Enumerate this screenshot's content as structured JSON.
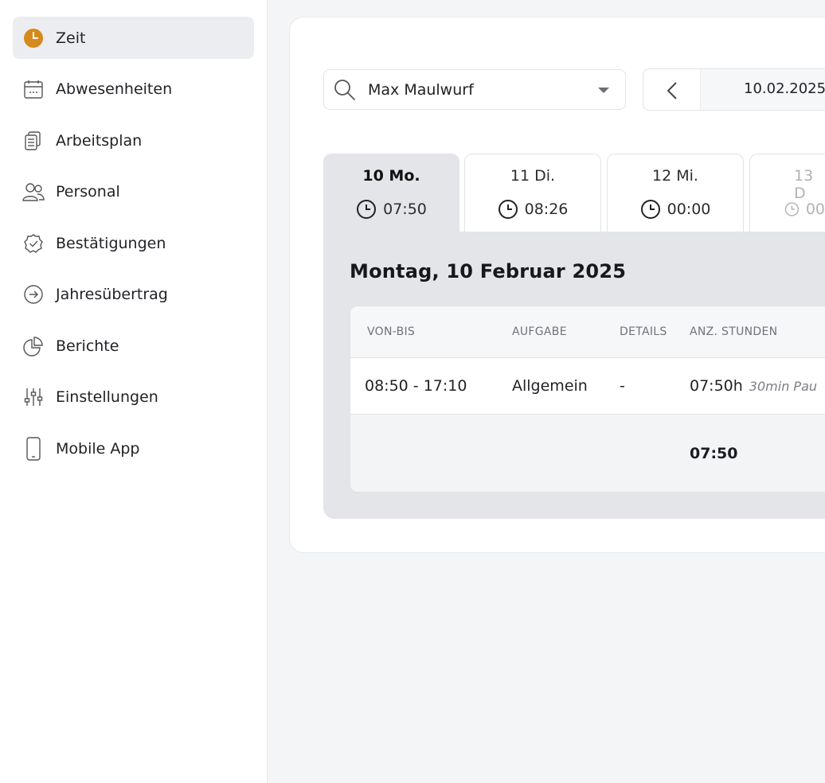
{
  "sidebar": {
    "items": [
      {
        "label": "Zeit",
        "icon": "clock-icon",
        "active": true
      },
      {
        "label": "Abwesenheiten",
        "icon": "calendar-icon"
      },
      {
        "label": "Arbeitsplan",
        "icon": "clipboard-icon"
      },
      {
        "label": "Personal",
        "icon": "users-icon"
      },
      {
        "label": "Bestätigungen",
        "icon": "badge-check-icon"
      },
      {
        "label": "Jahresübertrag",
        "icon": "arrow-circle-right-icon"
      },
      {
        "label": "Berichte",
        "icon": "pie-chart-icon"
      },
      {
        "label": "Einstellungen",
        "icon": "sliders-icon"
      },
      {
        "label": "Mobile App",
        "icon": "smartphone-icon"
      }
    ]
  },
  "filters": {
    "employee": "Max Maulwurf",
    "date": "10.02.2025"
  },
  "tabs": [
    {
      "day": "10 Mo.",
      "time": "07:50"
    },
    {
      "day": "11 Di.",
      "time": "08:26"
    },
    {
      "day": "12 Mi.",
      "time": "00:00"
    },
    {
      "day": "13 D",
      "time": "00"
    }
  ],
  "day_panel": {
    "title": "Montag, 10 Februar 2025",
    "columns": [
      "VON-BIS",
      "AUFGABE",
      "DETAILS",
      "ANZ. STUNDEN"
    ],
    "rows": [
      {
        "range": "08:50 - 17:10",
        "task": "Allgemein",
        "details": "-",
        "hours": "07:50h",
        "note": "30min Pau"
      }
    ],
    "total": "07:50"
  },
  "colors": {
    "accent": "#d48a1c",
    "sidebar_active_bg": "#ecedf0",
    "panel_bg": "#e4e5e8"
  }
}
